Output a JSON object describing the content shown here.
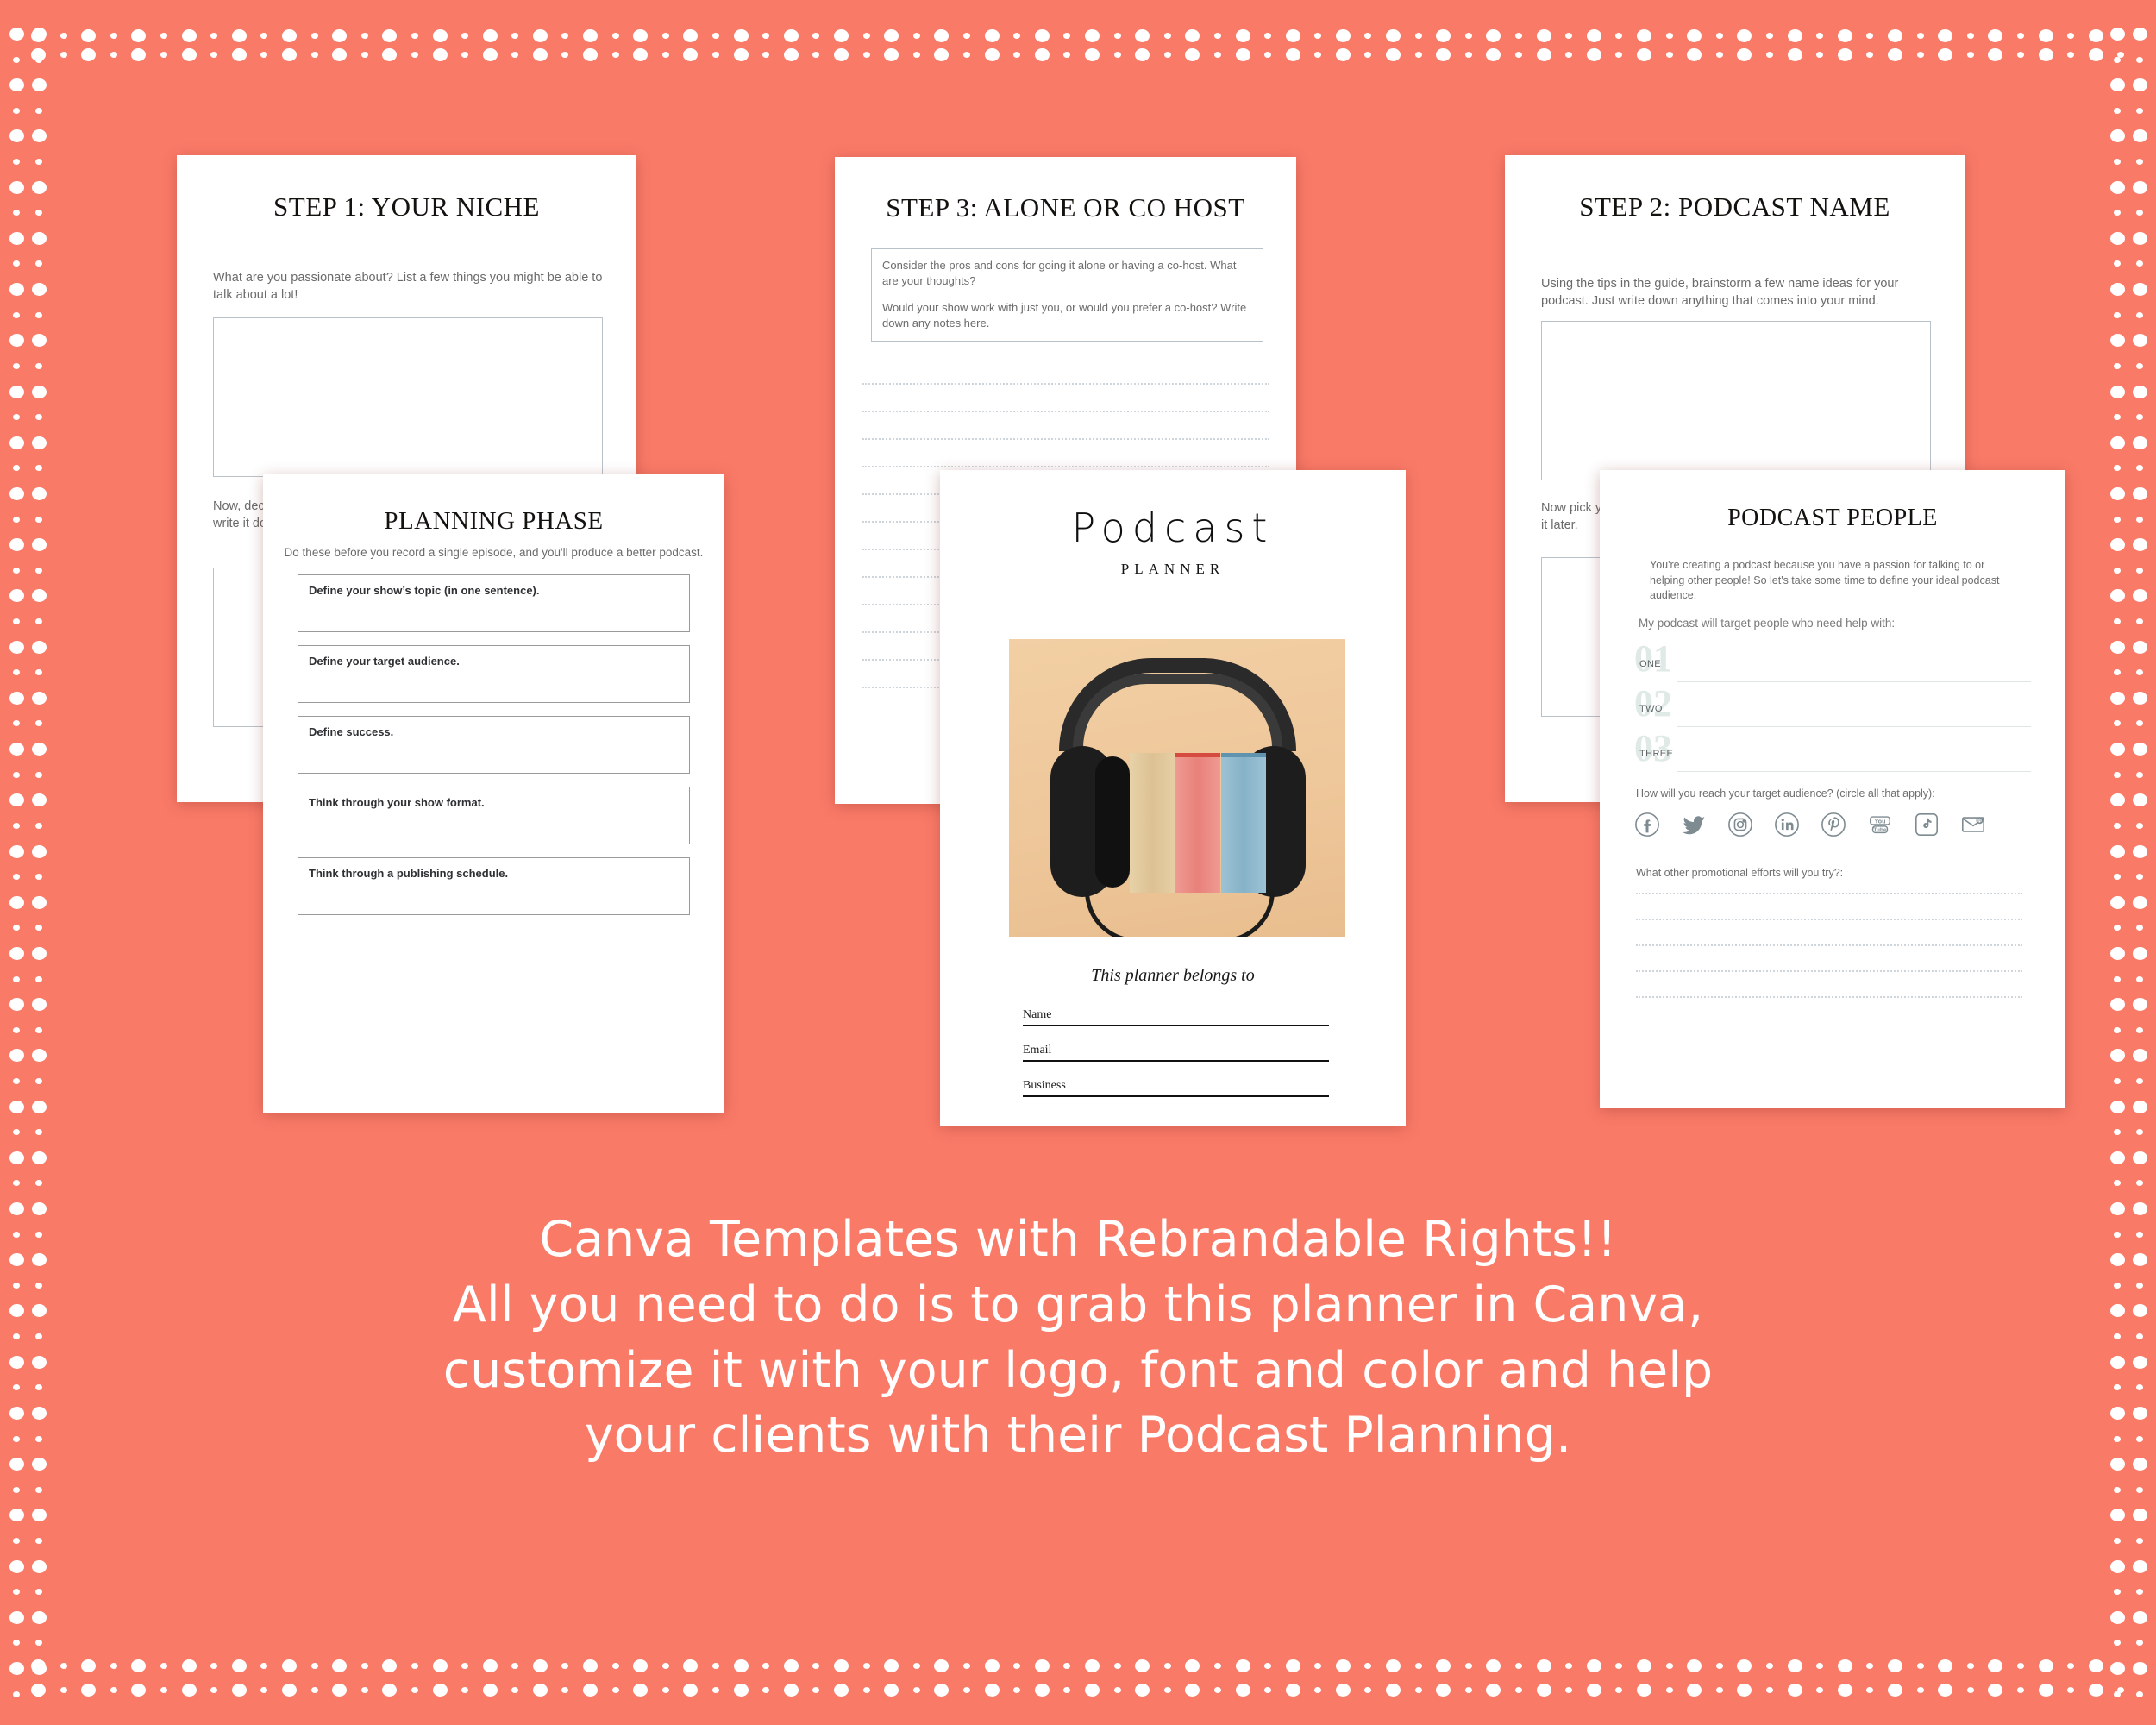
{
  "background_color": "#fa7a68",
  "cards": {
    "step1": {
      "title": "STEP 1: YOUR NICHE",
      "question1": "What are you passionate about?  List a few things you might be able to talk about a lot!",
      "question2": "Now, decide which one of these you want to build your podcast, and write it down below. You've got your niche!"
    },
    "step3": {
      "title": "STEP 3: ALONE OR CO HOST",
      "note_line1": "Consider the pros and cons for going it alone or having a co-host. What are your thoughts?",
      "note_line2": "Would your show work with just you, or would you prefer a co-host? Write down any notes here.",
      "writing_lines": 12
    },
    "step2": {
      "title": "STEP 2: PODCAST NAME",
      "question1": "Using the tips in the guide, brainstorm a few name ideas for your podcast. Just write down anything that comes into your mind.",
      "question2": "Now pick your favorite name and write it down below, so come back to it later."
    },
    "planning": {
      "title": "PLANNING PHASE",
      "subtitle": "Do these before you record a single episode, and  you'll produce a better podcast.",
      "items": [
        "Define your show’s topic (in one sentence).",
        "Define your target audience.",
        "Define success.",
        "Think through your show format.",
        "Think through a publishing schedule."
      ]
    },
    "cover": {
      "title": "Podcast",
      "subtitle": "PLANNER",
      "belongs_to": "This planner belongs to",
      "photo_alt": "headphones-over-books-photo",
      "fields": [
        "Name",
        "Email",
        "Business"
      ]
    },
    "people": {
      "title": "PODCAST PEOPLE",
      "intro": "You're creating a podcast because you have a passion for talking to or helping other people! So let's take some time to define your ideal podcast audience.",
      "target_question": "My podcast will target people who  need help with:",
      "numbered": [
        {
          "num": "01",
          "word": "ONE"
        },
        {
          "num": "02",
          "word": "TWO"
        },
        {
          "num": "03",
          "word": "THREE"
        }
      ],
      "reach_question": "How will you reach your target audience? (circle all that apply):",
      "social_icons": [
        "facebook-icon",
        "twitter-icon",
        "instagram-icon",
        "linkedin-icon",
        "pinterest-icon",
        "youtube-icon",
        "tiktok-icon",
        "email-icon"
      ],
      "promo_question": "What other promotional efforts will you try?:",
      "promo_lines": 5
    }
  },
  "promo": {
    "line1": "Canva Templates with Rebrandable Rights!!",
    "line2": "All you need to do is to grab this planner in Canva,",
    "line3": "customize it with your logo, font and color and help",
    "line4": "your clients with their Podcast Planning."
  }
}
